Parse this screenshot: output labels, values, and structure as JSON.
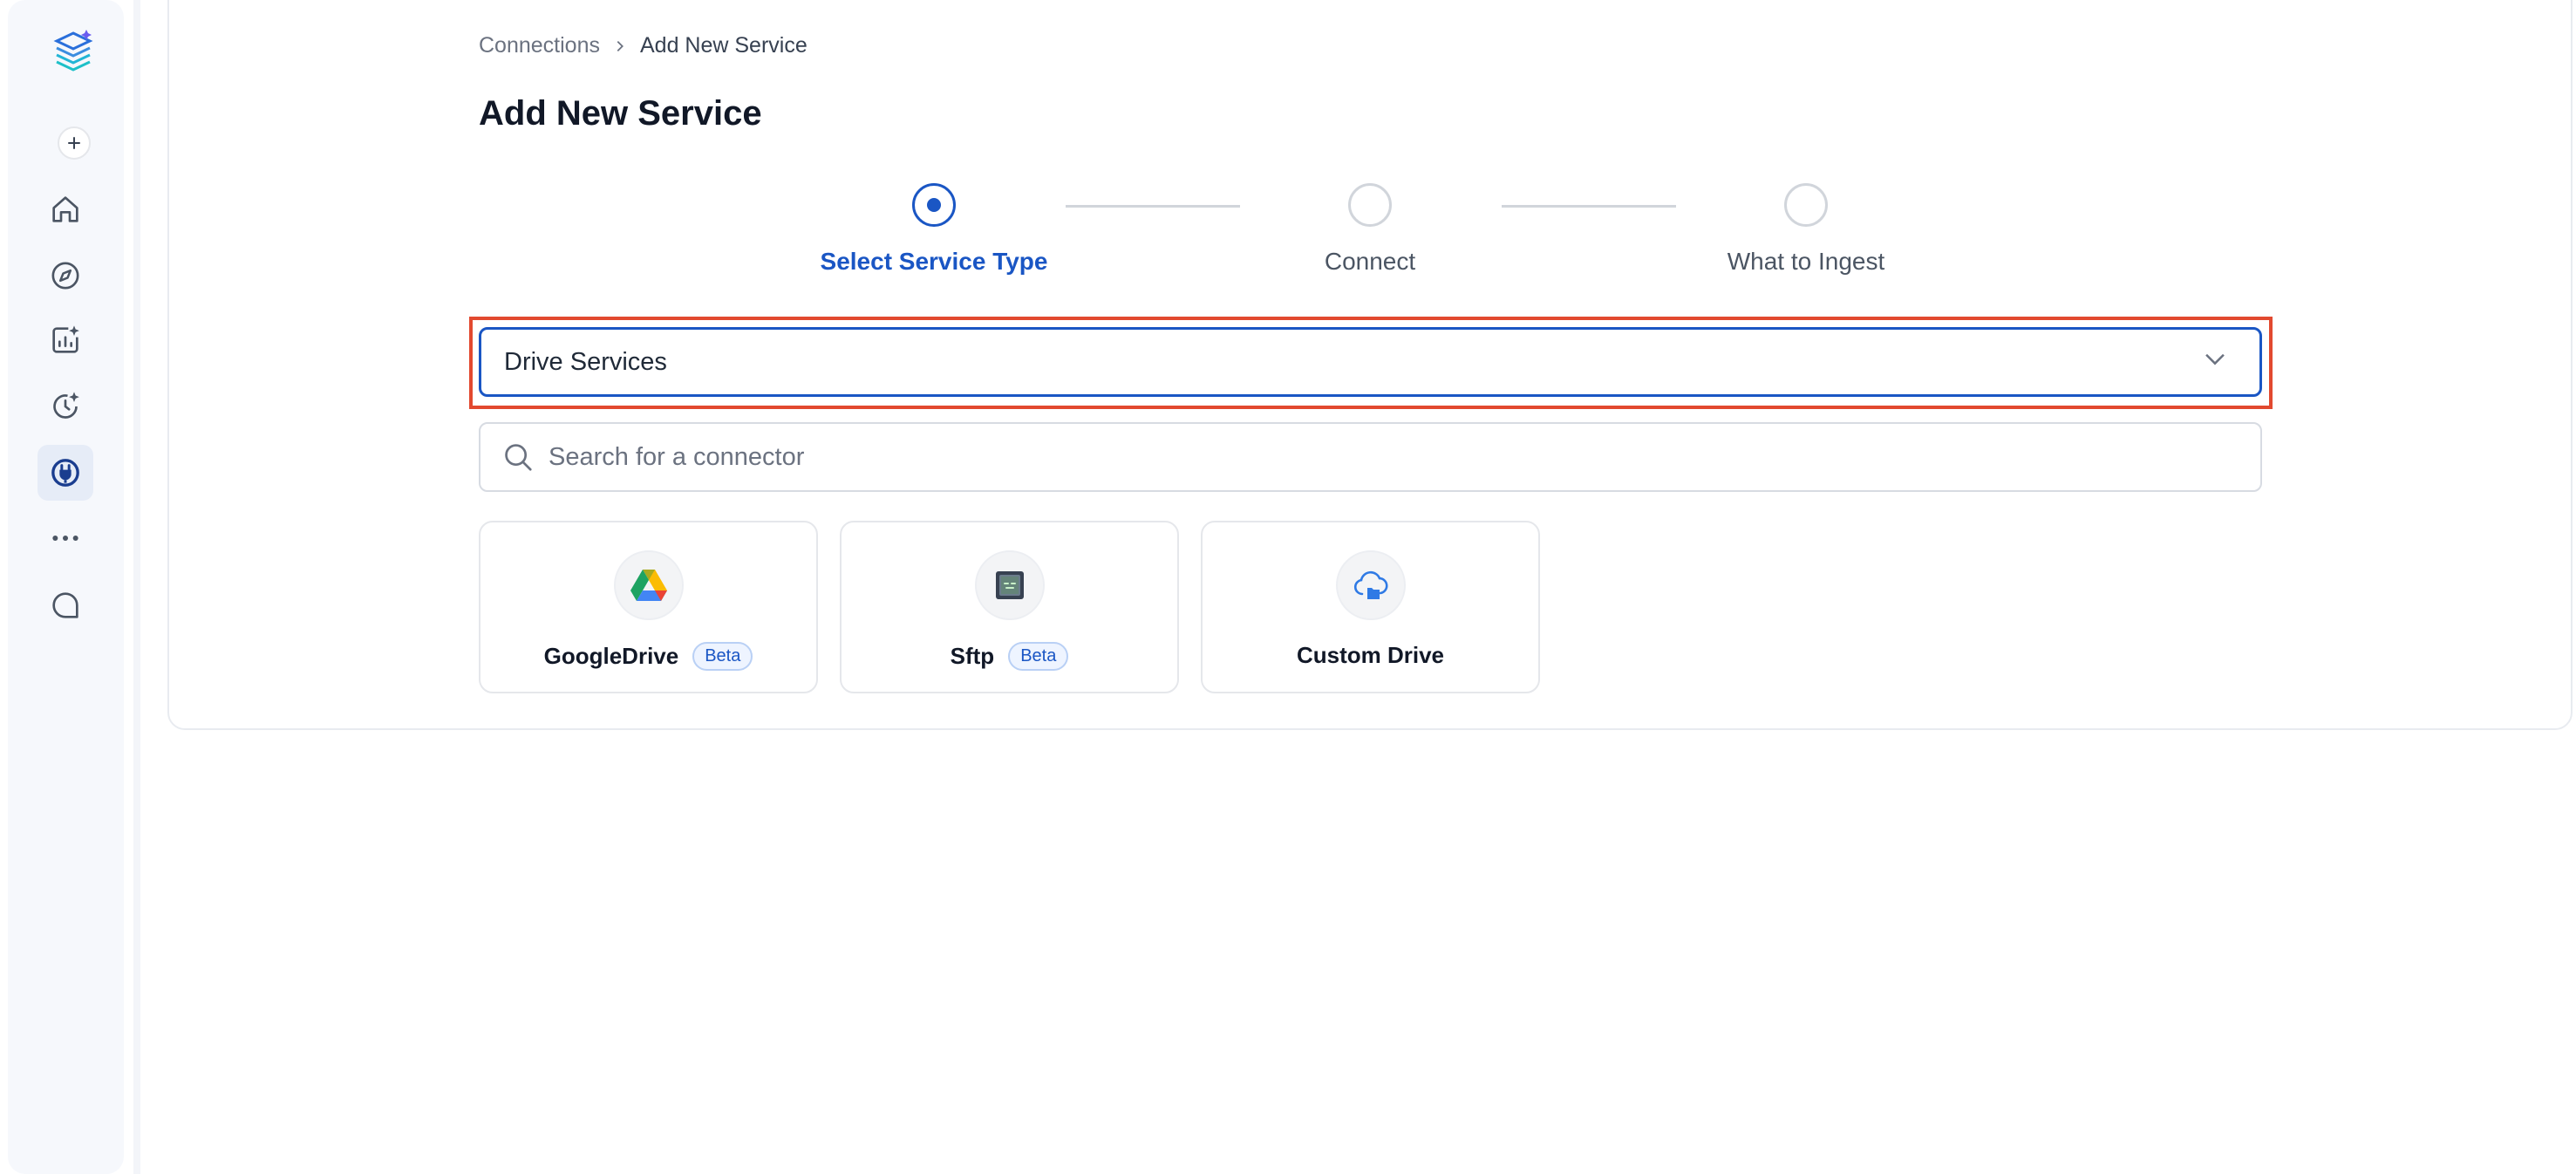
{
  "breadcrumb": {
    "parent": "Connections",
    "current": "Add New Service"
  },
  "page": {
    "title": "Add New Service"
  },
  "stepper": {
    "steps": [
      {
        "label": "Select Service Type",
        "state": "active"
      },
      {
        "label": "Connect",
        "state": "pending"
      },
      {
        "label": "What to Ingest",
        "state": "pending"
      }
    ]
  },
  "service_type_select": {
    "value": "Drive Services"
  },
  "search": {
    "placeholder": "Search for a connector",
    "value": ""
  },
  "connectors": [
    {
      "name": "GoogleDrive",
      "badge": "Beta",
      "icon": "google-drive-icon"
    },
    {
      "name": "Sftp",
      "badge": "Beta",
      "icon": "sftp-icon"
    },
    {
      "name": "Custom Drive",
      "badge": "",
      "icon": "cloud-folder-icon"
    }
  ],
  "sidebar": {
    "items": [
      {
        "icon": "plus-icon"
      },
      {
        "icon": "home-icon"
      },
      {
        "icon": "compass-icon"
      },
      {
        "icon": "insights-icon"
      },
      {
        "icon": "clock-sparkle-icon"
      },
      {
        "icon": "plug-icon",
        "active": true
      },
      {
        "icon": "more-icon"
      },
      {
        "icon": "chat-icon"
      }
    ]
  },
  "colors": {
    "accent": "#1a56c4",
    "highlight": "#e2492f"
  }
}
